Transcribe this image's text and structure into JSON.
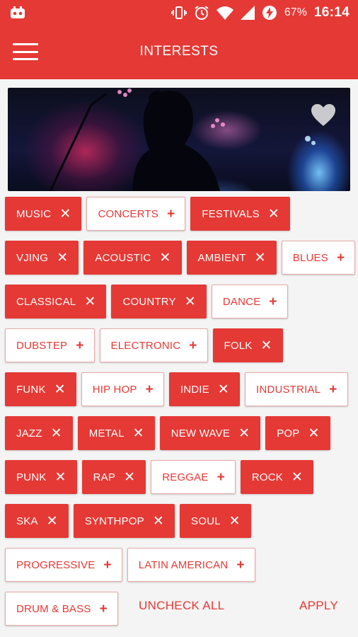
{
  "status_bar": {
    "time": "16:14",
    "battery_percent": "67%",
    "icons": [
      "app-notification-icon",
      "vibrate-icon",
      "alarm-icon",
      "wifi-icon",
      "signal-icon",
      "battery-saver-icon"
    ]
  },
  "appbar": {
    "title": "INTERESTS",
    "menu_icon": "hamburger-menu-icon"
  },
  "hero": {
    "favorite_icon": "heart-icon"
  },
  "chips": [
    {
      "label": "MUSIC",
      "selected": true
    },
    {
      "label": "CONCERTS",
      "selected": false
    },
    {
      "label": "FESTIVALS",
      "selected": true
    },
    {
      "label": "VJING",
      "selected": true
    },
    {
      "label": "ACOUSTIC",
      "selected": true
    },
    {
      "label": "AMBIENT",
      "selected": true
    },
    {
      "label": "BLUES",
      "selected": false
    },
    {
      "label": "CLASSICAL",
      "selected": true
    },
    {
      "label": "COUNTRY",
      "selected": true
    },
    {
      "label": "DANCE",
      "selected": false
    },
    {
      "label": "DUBSTEP",
      "selected": false
    },
    {
      "label": "ELECTRONIC",
      "selected": false
    },
    {
      "label": "FOLK",
      "selected": true
    },
    {
      "label": "FUNK",
      "selected": true
    },
    {
      "label": "HIP HOP",
      "selected": false
    },
    {
      "label": "INDIE",
      "selected": true
    },
    {
      "label": "INDUSTRIAL",
      "selected": false
    },
    {
      "label": "JAZZ",
      "selected": true
    },
    {
      "label": "METAL",
      "selected": true
    },
    {
      "label": "NEW WAVE",
      "selected": true
    },
    {
      "label": "POP",
      "selected": true
    },
    {
      "label": "PUNK",
      "selected": true
    },
    {
      "label": "RAP",
      "selected": true
    },
    {
      "label": "REGGAE",
      "selected": false
    },
    {
      "label": "ROCK",
      "selected": true
    },
    {
      "label": "SKA",
      "selected": true
    },
    {
      "label": "SYNTHPOP",
      "selected": true
    },
    {
      "label": "SOUL",
      "selected": true
    },
    {
      "label": "PROGRESSIVE",
      "selected": false
    },
    {
      "label": "LATIN AMERICAN",
      "selected": false
    },
    {
      "label": "DRUM & BASS",
      "selected": false
    }
  ],
  "chip_symbols": {
    "selected": "✕",
    "unselected": "+"
  },
  "footer": {
    "uncheck_all": "UNCHECK ALL",
    "apply": "APPLY"
  },
  "colors": {
    "accent": "#e53935",
    "background": "#f4f4f4"
  }
}
